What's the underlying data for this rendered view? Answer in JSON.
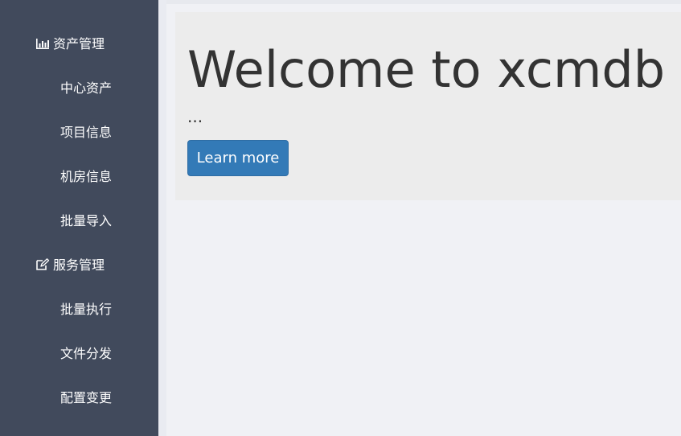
{
  "sidebar": {
    "asset_group": {
      "label": "资产管理",
      "icon": "bar-chart-icon"
    },
    "asset_items": [
      {
        "label": "中心资产"
      },
      {
        "label": "项目信息"
      },
      {
        "label": "机房信息"
      },
      {
        "label": "批量导入"
      }
    ],
    "service_group": {
      "label": "服务管理",
      "icon": "edit-icon"
    },
    "service_items": [
      {
        "label": "批量执行"
      },
      {
        "label": "文件分发"
      },
      {
        "label": "配置变更"
      }
    ]
  },
  "jumbotron": {
    "title": "Welcome to xcmdb",
    "text": "...",
    "button_label": "Learn more"
  },
  "colors": {
    "sidebar_bg": "#414a5c",
    "page_bg": "#f0f1f5",
    "jumbotron_bg": "#ececec",
    "primary_button": "#337ab7"
  }
}
